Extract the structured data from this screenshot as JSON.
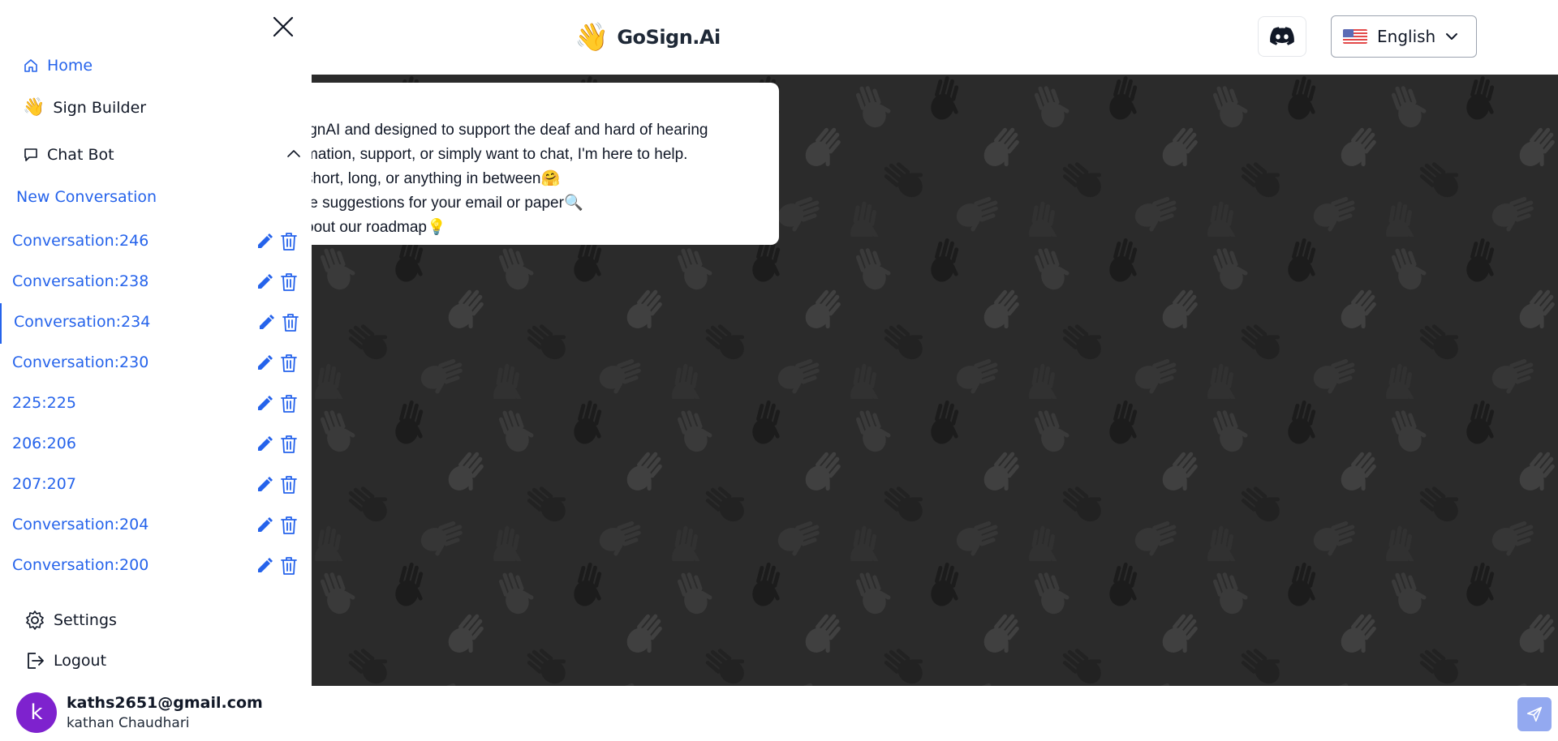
{
  "header": {
    "brand_emoji": "👋",
    "brand_name": "GoSign.Ai",
    "discord_icon": "discord-icon",
    "language": {
      "flag": "us-flag-icon",
      "label": "English"
    }
  },
  "sidebar": {
    "nav": {
      "home": "Home",
      "sign_builder_emoji": "👋",
      "sign_builder": "Sign Builder",
      "chat_bot": "Chat Bot",
      "new_conversation": "New Conversation"
    },
    "conversations": [
      {
        "label": "Conversation:246"
      },
      {
        "label": "Conversation:238"
      },
      {
        "label": "Conversation:234",
        "active": true
      },
      {
        "label": "Conversation:230"
      },
      {
        "label": "225:225"
      },
      {
        "label": "206:206"
      },
      {
        "label": "207:207"
      },
      {
        "label": "Conversation:204"
      },
      {
        "label": "Conversation:200"
      }
    ],
    "settings": "Settings",
    "logout": "Logout",
    "user": {
      "avatar_letter": "k",
      "email": "kaths2651@gmail.com",
      "name": "kathan Chaudhari"
    }
  },
  "chat": {
    "message_lines": [
      "ignAI and designed to support the deaf and hard of hearing",
      "mation, support, or simply want to chat, I'm here to help.",
      "short, long, or anything in between🤗",
      "te suggestions for your email or paper🔍",
      "oout our roadmap💡"
    ]
  },
  "colors": {
    "accent": "#2563eb",
    "chat_bg": "#2b2b2b",
    "avatar": "#7e22ce",
    "send_button": "#93a9f0"
  }
}
